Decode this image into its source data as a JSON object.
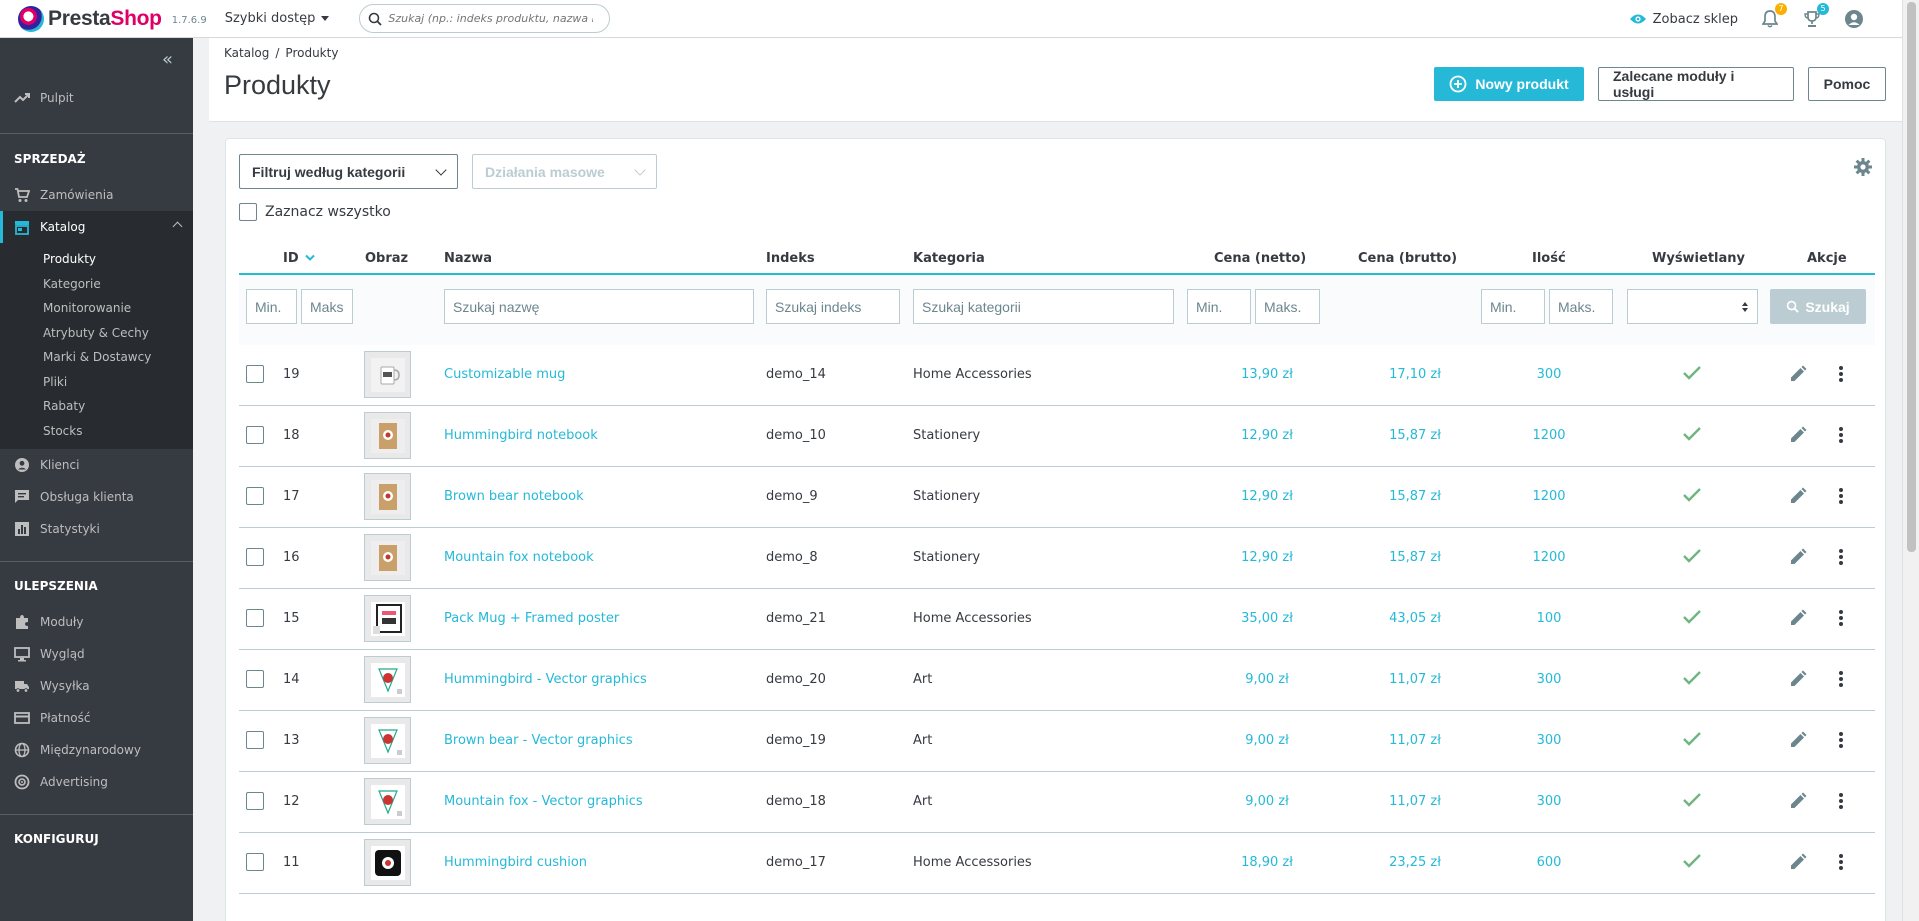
{
  "topbar": {
    "logo_prefix": "Presta",
    "logo_suffix": "Shop",
    "version": "1.7.6.9",
    "quick_access": "Szybki dostęp",
    "search_placeholder": "Szukaj (np.: indeks produktu, nazwa klienta…)",
    "view_shop": "Zobacz sklep",
    "notifications_badge": "7",
    "orders_badge": "5",
    "accent_color": "#25b9d7",
    "badge_color": "#fab000"
  },
  "sidebar": {
    "dashboard": "Pulpit",
    "sections": {
      "sell": "SPRZEDAŻ",
      "improve": "ULEPSZENIA",
      "configure": "KONFIGURUJ"
    },
    "sell_items": {
      "orders": "Zamówienia",
      "catalog": "Katalog",
      "customers": "Klienci",
      "customer_service": "Obsługa klienta",
      "stats": "Statystyki"
    },
    "catalog_sub": [
      "Produkty",
      "Kategorie",
      "Monitorowanie",
      "Atrybuty & Cechy",
      "Marki & Dostawcy",
      "Pliki",
      "Rabaty",
      "Stocks"
    ],
    "improve_items": {
      "modules": "Moduły",
      "design": "Wygląd",
      "shipping": "Wysyłka",
      "payment": "Płatność",
      "international": "Międzynarodowy",
      "advertising": "Advertising"
    }
  },
  "header": {
    "breadcrumb_1": "Katalog",
    "breadcrumb_sep": "/",
    "breadcrumb_2": "Produkty",
    "title": "Produkty",
    "new_product": "Nowy produkt",
    "recommended": "Zalecane moduły i usługi",
    "help": "Pomoc"
  },
  "toolbar": {
    "filter_category": "Filtruj według kategorii",
    "bulk_actions": "Działania masowe",
    "select_all": "Zaznacz wszystko"
  },
  "table": {
    "headers": {
      "id": "ID",
      "image": "Obraz",
      "name": "Nazwa",
      "reference": "Indeks",
      "category": "Kategoria",
      "price_net": "Cena (netto)",
      "price_gross": "Cena (brutto)",
      "quantity": "Ilość",
      "status": "Wyświetlany",
      "actions": "Akcje"
    },
    "filters": {
      "id_min": "Min.",
      "id_max": "Maks",
      "name": "Szukaj nazwę",
      "reference": "Szukaj indeks",
      "category": "Szukaj kategorii",
      "price_min": "Min.",
      "price_max": "Maks.",
      "qty_min": "Min.",
      "qty_max": "Maks.",
      "search_button": "Szukaj"
    },
    "rows": [
      {
        "id": "19",
        "name": "Customizable mug",
        "reference": "demo_14",
        "category": "Home Accessories",
        "price_net": "13,90 zł",
        "price_gross": "17,10 zł",
        "quantity": "300",
        "thumb": "mug"
      },
      {
        "id": "18",
        "name": "Hummingbird notebook",
        "reference": "demo_10",
        "category": "Stationery",
        "price_net": "12,90 zł",
        "price_gross": "15,87 zł",
        "quantity": "1200",
        "thumb": "notebook"
      },
      {
        "id": "17",
        "name": "Brown bear notebook",
        "reference": "demo_9",
        "category": "Stationery",
        "price_net": "12,90 zł",
        "price_gross": "15,87 zł",
        "quantity": "1200",
        "thumb": "notebook"
      },
      {
        "id": "16",
        "name": "Mountain fox notebook",
        "reference": "demo_8",
        "category": "Stationery",
        "price_net": "12,90 zł",
        "price_gross": "15,87 zł",
        "quantity": "1200",
        "thumb": "notebook"
      },
      {
        "id": "15",
        "name": "Pack Mug + Framed poster",
        "reference": "demo_21",
        "category": "Home Accessories",
        "price_net": "35,00 zł",
        "price_gross": "43,05 zł",
        "quantity": "100",
        "thumb": "poster"
      },
      {
        "id": "14",
        "name": "Hummingbird - Vector graphics",
        "reference": "demo_20",
        "category": "Art",
        "price_net": "9,00 zł",
        "price_gross": "11,07 zł",
        "quantity": "300",
        "thumb": "vector"
      },
      {
        "id": "13",
        "name": "Brown bear - Vector graphics",
        "reference": "demo_19",
        "category": "Art",
        "price_net": "9,00 zł",
        "price_gross": "11,07 zł",
        "quantity": "300",
        "thumb": "vector"
      },
      {
        "id": "12",
        "name": "Mountain fox - Vector graphics",
        "reference": "demo_18",
        "category": "Art",
        "price_net": "9,00 zł",
        "price_gross": "11,07 zł",
        "quantity": "300",
        "thumb": "vector"
      },
      {
        "id": "11",
        "name": "Hummingbird cushion",
        "reference": "demo_17",
        "category": "Home Accessories",
        "price_net": "18,90 zł",
        "price_gross": "23,25 zł",
        "quantity": "600",
        "thumb": "cushion"
      }
    ]
  }
}
